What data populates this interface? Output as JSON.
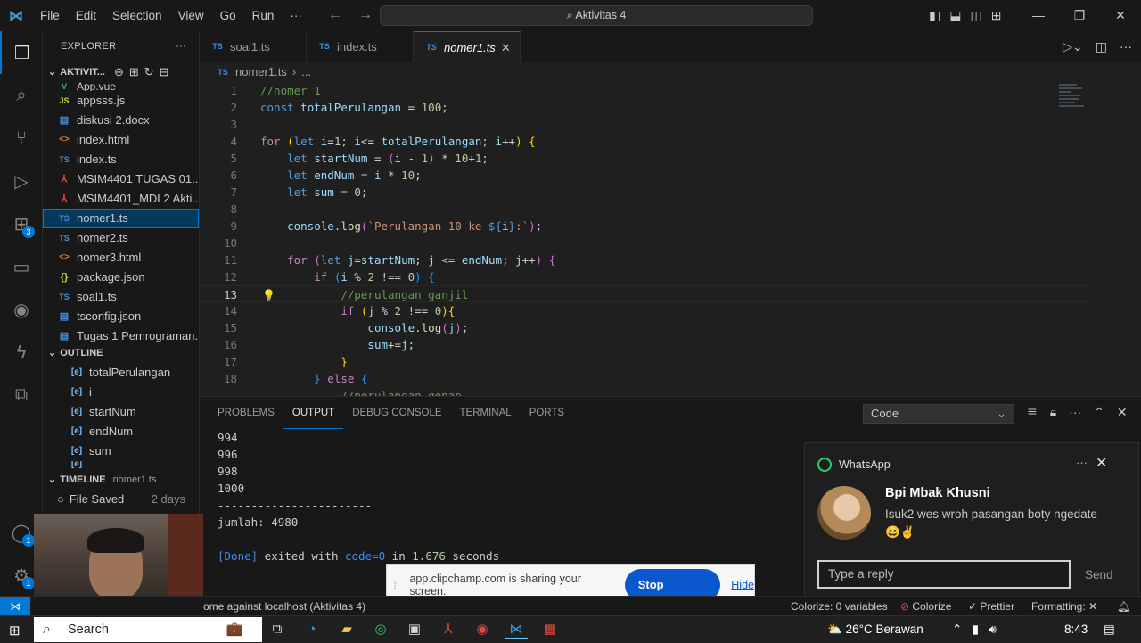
{
  "titlebar": {
    "menu": [
      "File",
      "Edit",
      "Selection",
      "View",
      "Go",
      "Run",
      "···"
    ],
    "command_center": "Aktivitas 4"
  },
  "sidebar": {
    "explorer_title": "EXPLORER",
    "folder_name": "AKTIVIT...",
    "partial_file": "App.vue",
    "files": [
      {
        "icon": "JS",
        "type": "js",
        "name": "appsss.js"
      },
      {
        "icon": "▤",
        "type": "doc",
        "name": "diskusi 2.docx"
      },
      {
        "icon": "<>",
        "type": "html",
        "name": "index.html"
      },
      {
        "icon": "TS",
        "type": "ts",
        "name": "index.ts"
      },
      {
        "icon": "⅄",
        "type": "pdf",
        "name": "MSIM4401 TUGAS 01...."
      },
      {
        "icon": "⅄",
        "type": "pdf",
        "name": "MSIM4401_MDL2 Akti..."
      },
      {
        "icon": "TS",
        "type": "ts",
        "name": "nomer1.ts",
        "selected": true
      },
      {
        "icon": "TS",
        "type": "ts",
        "name": "nomer2.ts"
      },
      {
        "icon": "<>",
        "type": "html",
        "name": "nomer3.html"
      },
      {
        "icon": "{}",
        "type": "json",
        "name": "package.json"
      },
      {
        "icon": "TS",
        "type": "ts",
        "name": "soal1.ts"
      },
      {
        "icon": "▤",
        "type": "doc",
        "name": "tsconfig.json"
      },
      {
        "icon": "▤",
        "type": "doc",
        "name": "Tugas 1 Pemrograman..."
      }
    ],
    "outline_title": "OUTLINE",
    "outline": [
      "totalPerulangan",
      "i",
      "startNum",
      "endNum",
      "sum"
    ],
    "timeline_title": "TIMELINE",
    "timeline_file": "nomer1.ts",
    "timeline_entry": "File Saved",
    "timeline_time": "2 days"
  },
  "tabs": [
    {
      "icon": "TS",
      "label": "soal1.ts"
    },
    {
      "icon": "TS",
      "label": "index.ts"
    },
    {
      "icon": "TS",
      "label": "nomer1.ts",
      "active": true
    }
  ],
  "breadcrumb": {
    "icon": "TS",
    "file": "nomer1.ts",
    "rest": "..."
  },
  "editor": {
    "line_numbers": [
      "1",
      "2",
      "3",
      "4",
      "5",
      "6",
      "7",
      "8",
      "9",
      "10",
      "11",
      "12",
      "13",
      "14",
      "15",
      "16",
      "17",
      "18"
    ],
    "current_line": "13"
  },
  "panel": {
    "tabs": [
      "PROBLEMS",
      "OUTPUT",
      "DEBUG CONSOLE",
      "TERMINAL",
      "PORTS"
    ],
    "active_tab": "OUTPUT",
    "channel": "Code",
    "output": [
      "994",
      "996",
      "998",
      "1000",
      "-----------------------",
      "jumlah: 4980"
    ],
    "done_tag": "[Done]",
    "done_text": " exited with ",
    "done_code": "code=0",
    "done_in": " in ",
    "done_time": "1.676",
    "done_unit": " seconds"
  },
  "whatsapp": {
    "app": "WhatsApp",
    "sender": "Bpi Mbak Khusni",
    "message": "Isuk2 wes wroh pasangan boty ngedate 😄✌",
    "reply_placeholder": "Type a reply",
    "send": "Send"
  },
  "share_bar": {
    "text": "app.clipchamp.com is sharing your screen.",
    "stop": "Stop sharing",
    "hide": "Hide"
  },
  "statusbar": {
    "live_share": "ome against localhost (Aktivitas 4)",
    "colorize_vars": "Colorize: 0 variables",
    "colorize": "Colorize",
    "prettier": "Prettier",
    "formatting": "Formatting: ✕"
  },
  "taskbar": {
    "search": "Search",
    "weather": "26°C  Berawan",
    "time": "8:43"
  },
  "activity_badges": {
    "extensions": "3",
    "accounts": "1",
    "settings": "1"
  }
}
